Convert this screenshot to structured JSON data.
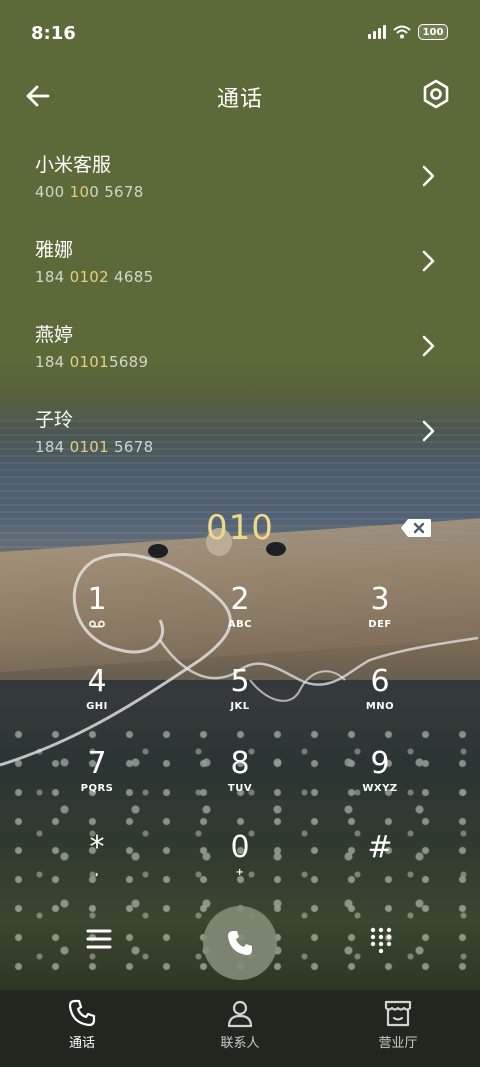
{
  "status_bar": {
    "time": "8:16",
    "battery": "100",
    "icons": [
      "signal-icon",
      "wifi-icon",
      "battery-icon"
    ]
  },
  "header": {
    "title": "通话",
    "back_icon": "arrow-left-icon",
    "settings_icon": "settings-hexagon-icon"
  },
  "contacts": [
    {
      "name": "小米客服",
      "num_pre": "400 ",
      "num_hl": "10",
      "num_post": "0 5678"
    },
    {
      "name": "雅娜",
      "num_pre": "184 ",
      "num_hl": "0102",
      "num_post": " 4685"
    },
    {
      "name": "燕婷",
      "num_pre": "184 ",
      "num_hl": "0101",
      "num_post": "5689"
    },
    {
      "name": "子玲",
      "num_pre": "184 ",
      "num_hl": "0101",
      "num_post": " 5678"
    }
  ],
  "dialer": {
    "input": "010"
  },
  "keypad": [
    {
      "digit": "1",
      "letters": ""
    },
    {
      "digit": "2",
      "letters": "ABC"
    },
    {
      "digit": "3",
      "letters": "DEF"
    },
    {
      "digit": "4",
      "letters": "GHI"
    },
    {
      "digit": "5",
      "letters": "JKL"
    },
    {
      "digit": "6",
      "letters": "MNO"
    },
    {
      "digit": "7",
      "letters": "PQRS"
    },
    {
      "digit": "8",
      "letters": "TUV"
    },
    {
      "digit": "9",
      "letters": "WXYZ"
    },
    {
      "digit": "*",
      "letters": ","
    },
    {
      "digit": "0",
      "letters": "+"
    },
    {
      "digit": "#",
      "letters": ""
    }
  ],
  "nav": [
    {
      "label": "通话",
      "icon": "phone-icon",
      "active": true
    },
    {
      "label": "联系人",
      "icon": "person-icon",
      "active": false
    },
    {
      "label": "营业厅",
      "icon": "store-icon",
      "active": false
    }
  ],
  "colors": {
    "accent_gold": "#e6cf7e",
    "olive_bg": "#5b6a38",
    "call_button": "#828c78"
  }
}
